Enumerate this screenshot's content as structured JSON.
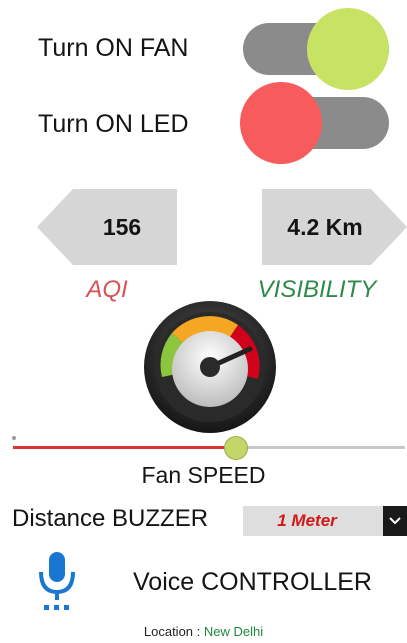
{
  "controls": {
    "fan_toggle": {
      "label": "Turn ON FAN",
      "on": true,
      "knob_color": "#c8e264"
    },
    "led_toggle": {
      "label": "Turn ON LED",
      "on": false,
      "knob_color": "#f75b5b"
    }
  },
  "readings": {
    "aqi": {
      "value": "156",
      "label": "AQI",
      "label_color": "#d85454"
    },
    "visibility": {
      "value": "4.2 Km",
      "label": "VISIBILITY",
      "label_color": "#2f8a4a"
    }
  },
  "fan_speed": {
    "label": "Fan SPEED",
    "level": 0.57
  },
  "distance_buzzer": {
    "label": "Distance BUZZER",
    "selected": "1 Meter"
  },
  "voice": {
    "label": "Voice CONTROLLER",
    "icon": "microphone-icon"
  },
  "location": {
    "prefix": "Location : ",
    "city": "New Delhi"
  },
  "icons": {
    "gauge": "speedometer-icon",
    "dropdown": "chevron-down-icon"
  }
}
